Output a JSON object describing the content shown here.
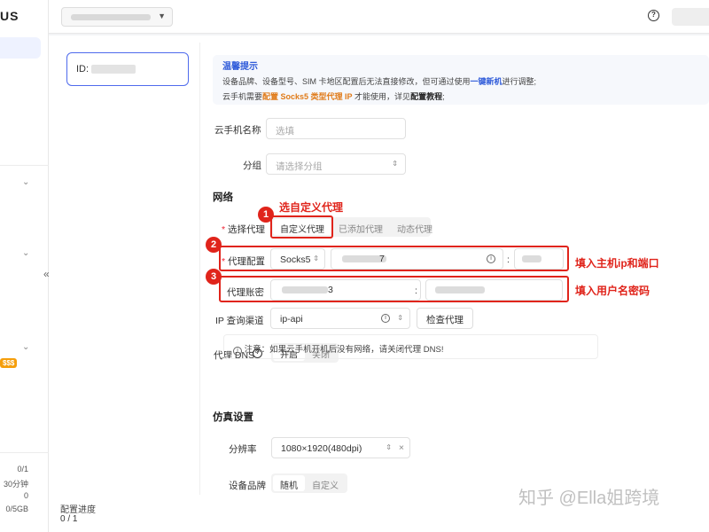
{
  "sidebar": {
    "logo": "US",
    "badge": "$$$",
    "stats": [
      "0/1",
      "30分钟",
      "0",
      "0/5GB"
    ]
  },
  "topbar": {
    "help": "?"
  },
  "device": {
    "id_label": "ID:"
  },
  "notice": {
    "title": "温馨提示",
    "line1_a": "设备品牌、设备型号、SIM 卡地区配置后无法直接修改，但可通过使用",
    "line1_link": "一键新机",
    "line1_b": "进行调整;",
    "line2_a": "云手机需要",
    "line2_hl": "配置 Socks5 类型代理 IP",
    "line2_b": " 才能使用，详见",
    "line2_link": "配置教程",
    "line2_c": ";"
  },
  "form": {
    "name_label": "云手机名称",
    "name_placeholder": "选填",
    "group_label": "分组",
    "group_placeholder": "请选择分组",
    "network_title": "网络",
    "proxy_select_label": "选择代理",
    "proxy_options": [
      "自定义代理",
      "已添加代理",
      "动态代理"
    ],
    "proxy_config_label": "代理配置",
    "proxy_type": "Socks5",
    "proxy_host_tail": "7",
    "colon": ":",
    "proxy_account_label": "代理账密",
    "account_tail": "3",
    "ip_channel_label": "IP 查询渠道",
    "ip_channel_value": "ip-api",
    "check_button": "检查代理",
    "dns_label": "代理 DNS",
    "dns_options": [
      "开启",
      "关闭"
    ],
    "dns_tip": "注意：如果云手机开机后没有网络，请关闭代理 DNS!",
    "sim_title": "仿真设置",
    "resolution_label": "分辨率",
    "resolution_value": "1080×1920(480dpi)",
    "brand_label": "设备品牌",
    "brand_options": [
      "随机",
      "自定义"
    ]
  },
  "annotations": {
    "step1": "1",
    "step1_text": "选自定义代理",
    "step2": "2",
    "step2_text": "填入主机ip和端口",
    "step3": "3",
    "step3_text": "填入用户名密码"
  },
  "footer": {
    "progress_label": "配置进度",
    "progress_value": "0 / 1"
  },
  "watermark": "知乎 @Ella姐跨境"
}
